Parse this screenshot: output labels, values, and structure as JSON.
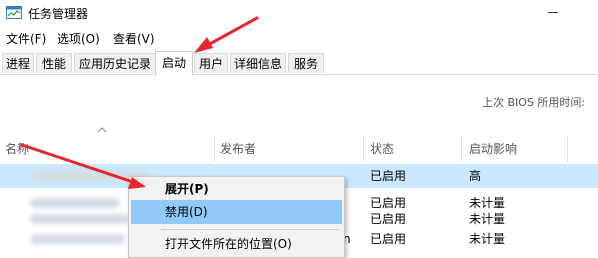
{
  "window": {
    "title": "任务管理器"
  },
  "menu": [
    "文件(F)",
    "选项(O)",
    "查看(V)"
  ],
  "tabs": [
    {
      "label": "进程"
    },
    {
      "label": "性能"
    },
    {
      "label": "应用历史记录"
    },
    {
      "label": "启动",
      "active": true
    },
    {
      "label": "用户"
    },
    {
      "label": "详细信息"
    },
    {
      "label": "服务"
    }
  ],
  "bios": {
    "label": "上次 BIOS 所用时间:"
  },
  "columns": {
    "name": "名称",
    "publisher": "发布者",
    "status": "状态",
    "impact": "启动影响"
  },
  "rows": [
    {
      "status": "已启用",
      "impact": "高",
      "selected": true
    },
    {
      "status": "已启用",
      "impact": "未计量"
    },
    {
      "status": "已启用",
      "impact": "未计量"
    },
    {
      "status": "已启用",
      "impact": "未计量"
    }
  ],
  "partial_publisher_char": "n",
  "context_menu": {
    "items": [
      {
        "label": "展开(P)",
        "bold": true
      },
      {
        "label": "禁用(D)",
        "highlighted": true
      },
      {
        "label": "打开文件所在的位置(O)"
      }
    ]
  },
  "colors": {
    "selected_row": "#cce8ff",
    "menu_highlight": "#91c9f7",
    "annotation_arrow": "#e8262b"
  }
}
